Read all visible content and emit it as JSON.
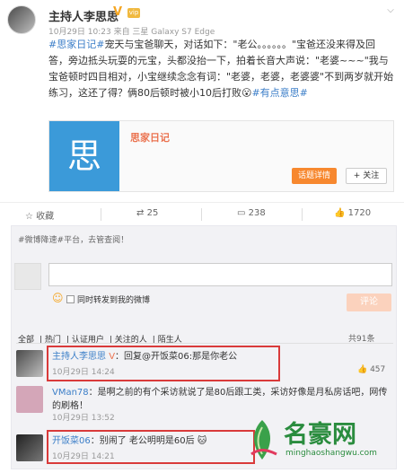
{
  "post": {
    "author": "主持人李思思",
    "v": "V",
    "vip": "vip",
    "meta": "10月29日 10:23 来自 三星 Galaxy S7 Edge",
    "text_parts": {
      "tag1": "#思家日记#",
      "body1": "宠天与宝爸聊天，对话如下：\"老公。。。。。。\"宝爸还没来得及回答，旁边抵头玩耍的元宝，头都没抬一下，拍着长音大声说：\"老婆~~~\"我与宝爸顿时四目相对，小宝继续念念有词：\"老婆，老婆，老婆婆\"不到两岁就开始练习，这还了得？俩80后顿时被小10后打败",
      "emoji": "😮",
      "tag2": "#有点意思#"
    },
    "card": {
      "thumb_char": "思",
      "title": "思家日记",
      "detail_btn": "话题详情",
      "follow_btn": "+ 关注"
    },
    "actions": {
      "favorite": "收藏",
      "repost": "25",
      "comment": "238",
      "like": "1720"
    }
  },
  "comment_area": {
    "promo": "#微博降速#平台，去管查阅！",
    "input_placeholder": "",
    "also_post": "同时转发到我的微博",
    "submit": "评论",
    "filters": [
      "全部",
      "热门",
      "认证用户",
      "关注的人",
      "陌生人"
    ],
    "total": "共91条"
  },
  "comments": [
    {
      "name": "主持人李思思",
      "badge": "V",
      "text": "：回复@开饭菜06:那是你老公",
      "time": "10月29日 14:24",
      "likes": "457"
    },
    {
      "name": "VMan78",
      "text": "：是啊之前的有个采访就说了是80后跟工类，采访好像是月私房话吧，网传的刷格！",
      "time": "10月29日 13:52"
    },
    {
      "name": "开饭菜06",
      "text": "：别闹了 老公明明是60后",
      "time": "10月29日 14:21"
    }
  ],
  "watermark": {
    "title": "名豪网",
    "url": "minghaoshangwu.com"
  },
  "colors": {
    "accent": "#eb7350",
    "link": "#3b7ec8",
    "highlight_box": "#d93a3a",
    "watermark": "#2a8c3e"
  }
}
